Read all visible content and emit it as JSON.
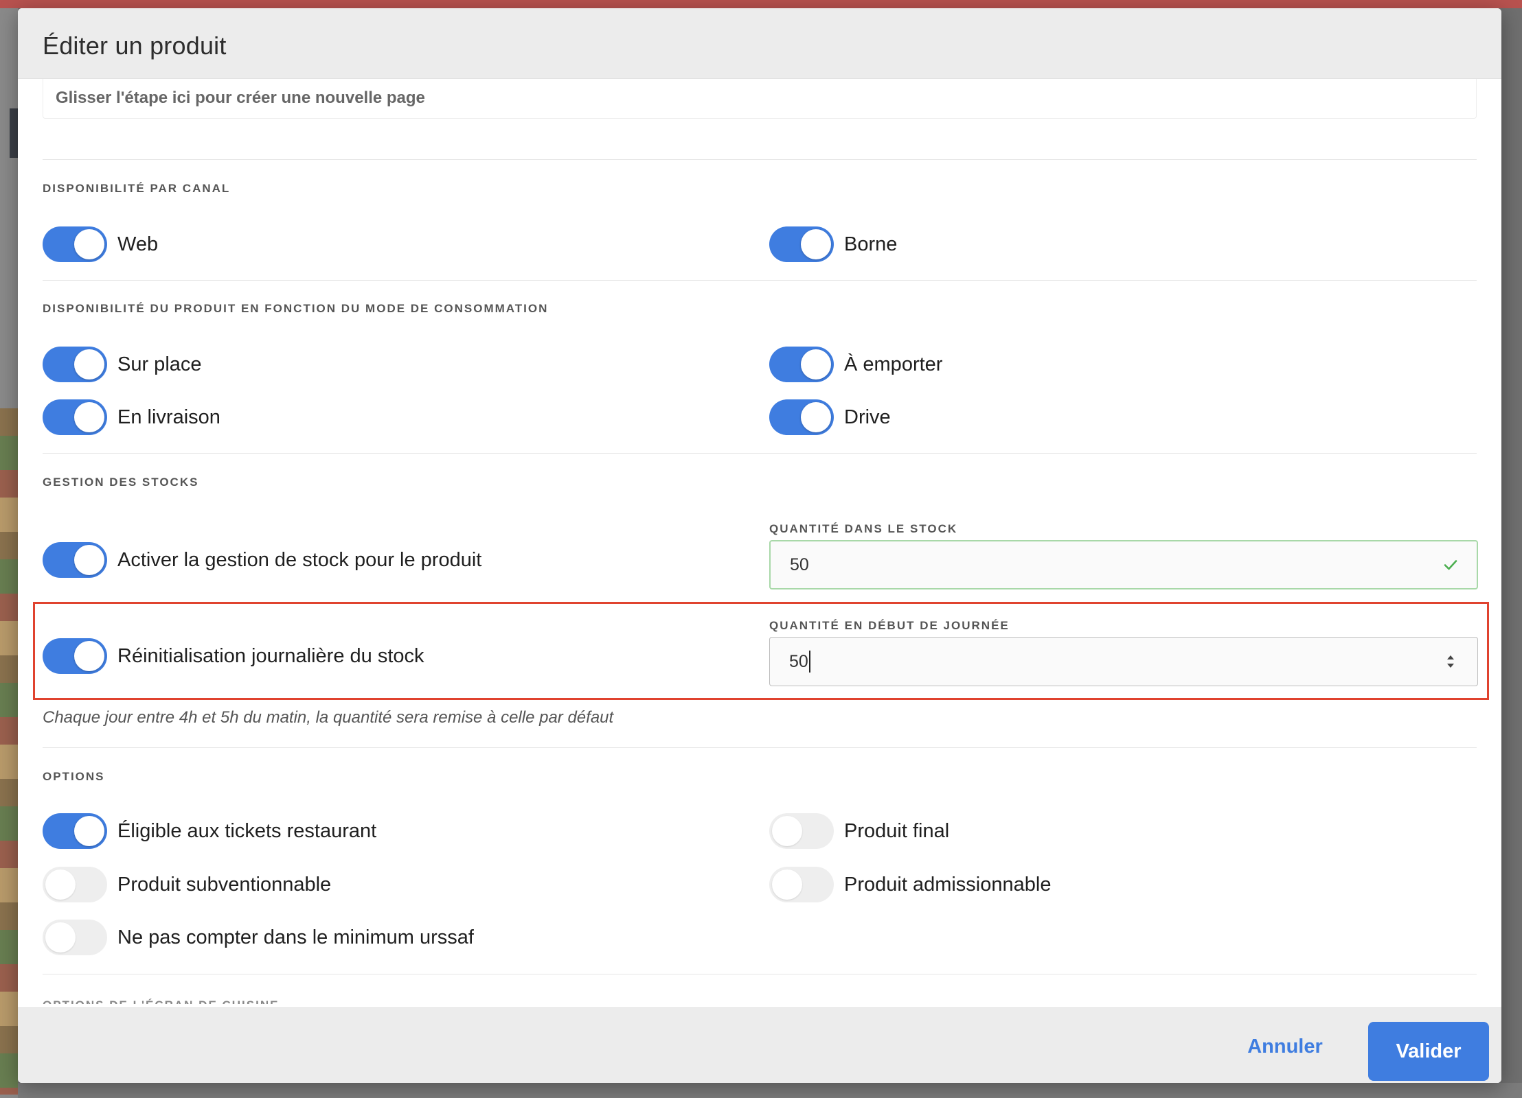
{
  "modal": {
    "title": "Éditer un produit",
    "drop_zone_text": "Glisser l'étape ici pour créer une nouvelle page"
  },
  "channel": {
    "title": "DISPONIBILITÉ PAR CANAL",
    "toggles": [
      {
        "label": "Web",
        "on": true
      },
      {
        "label": "Borne",
        "on": true
      }
    ]
  },
  "consumption": {
    "title": "DISPONIBILITÉ DU PRODUIT EN FONCTION DU MODE DE CONSOMMATION",
    "toggles": [
      {
        "label": "Sur place",
        "on": true
      },
      {
        "label": "À emporter",
        "on": true
      },
      {
        "label": "En livraison",
        "on": true
      },
      {
        "label": "Drive",
        "on": true
      }
    ]
  },
  "stock": {
    "title": "GESTION DES STOCKS",
    "enable_label": "Activer la gestion de stock pour le produit",
    "enable_on": true,
    "quantity_label": "QUANTITÉ DANS LE STOCK",
    "quantity_value": "50",
    "daily_reset_label": "Réinitialisation journalière du stock",
    "daily_reset_on": true,
    "start_quantity_label": "QUANTITÉ EN DÉBUT DE JOURNÉE",
    "start_quantity_value": "50",
    "hint": "Chaque jour entre 4h et 5h du matin, la quantité sera remise à celle par défaut"
  },
  "options": {
    "title": "OPTIONS",
    "toggles": [
      {
        "label": "Éligible aux tickets restaurant",
        "on": true
      },
      {
        "label": "Produit final",
        "on": false
      },
      {
        "label": "Produit subventionnable",
        "on": false
      },
      {
        "label": "Produit admissionnable",
        "on": false
      },
      {
        "label": "Ne pas compter dans le minimum urssaf",
        "on": false
      }
    ]
  },
  "next_section_title": "OPTIONS DE L'ÉCRAN DE CUISINE",
  "footer": {
    "cancel_label": "Annuler",
    "submit_label": "Valider"
  },
  "colors": {
    "accent": "#3f7de0",
    "highlight": "#e0432f",
    "valid_border": "#a8d8a8"
  }
}
